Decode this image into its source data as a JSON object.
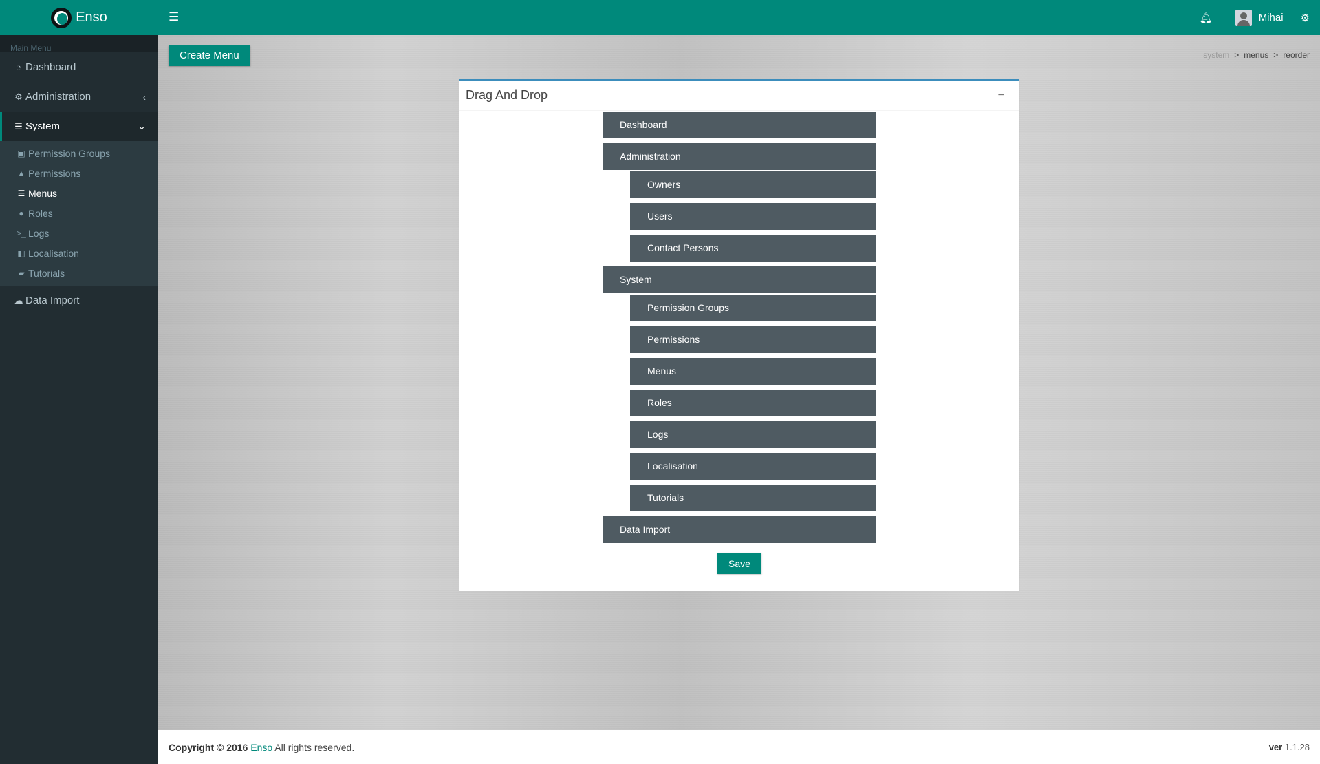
{
  "app": {
    "name": "Enso"
  },
  "sidebar": {
    "section_label": "Main Menu",
    "items": [
      {
        "label": "Dashboard",
        "icon": "dashboard-icon"
      },
      {
        "label": "Administration",
        "icon": "cogs-icon"
      },
      {
        "label": "System",
        "icon": "sliders-icon"
      },
      {
        "label": "Data Import",
        "icon": "cloud-upload-icon"
      }
    ],
    "system_children": [
      {
        "label": "Permission Groups",
        "icon": "object-group-icon"
      },
      {
        "label": "Permissions",
        "icon": "warning-icon"
      },
      {
        "label": "Menus",
        "icon": "list-icon"
      },
      {
        "label": "Roles",
        "icon": "info-circle-icon"
      },
      {
        "label": "Logs",
        "icon": "terminal-icon"
      },
      {
        "label": "Localisation",
        "icon": "language-icon"
      },
      {
        "label": "Tutorials",
        "icon": "book-icon"
      }
    ]
  },
  "header": {
    "user_name": "Mihai"
  },
  "toolbar": {
    "create_label": "Create Menu"
  },
  "breadcrumb": [
    "system",
    "menus",
    "reorder"
  ],
  "box": {
    "title": "Drag And Drop",
    "tree": {
      "dashboard": "Dashboard",
      "administration": "Administration",
      "admin_children": [
        "Owners",
        "Users",
        "Contact Persons"
      ],
      "system": "System",
      "system_children": [
        "Permission Groups",
        "Permissions",
        "Menus",
        "Roles",
        "Logs",
        "Localisation",
        "Tutorials"
      ],
      "data_import": "Data Import"
    },
    "save_label": "Save"
  },
  "footer": {
    "copyright_prefix": "Copyright © 2016",
    "brand": "Enso",
    "rights": "All rights reserved.",
    "version_label": "ver",
    "version": "1.1.28"
  },
  "colors": {
    "accent": "#00897b",
    "sidebar": "#222d32",
    "node": "#4f5b62"
  }
}
